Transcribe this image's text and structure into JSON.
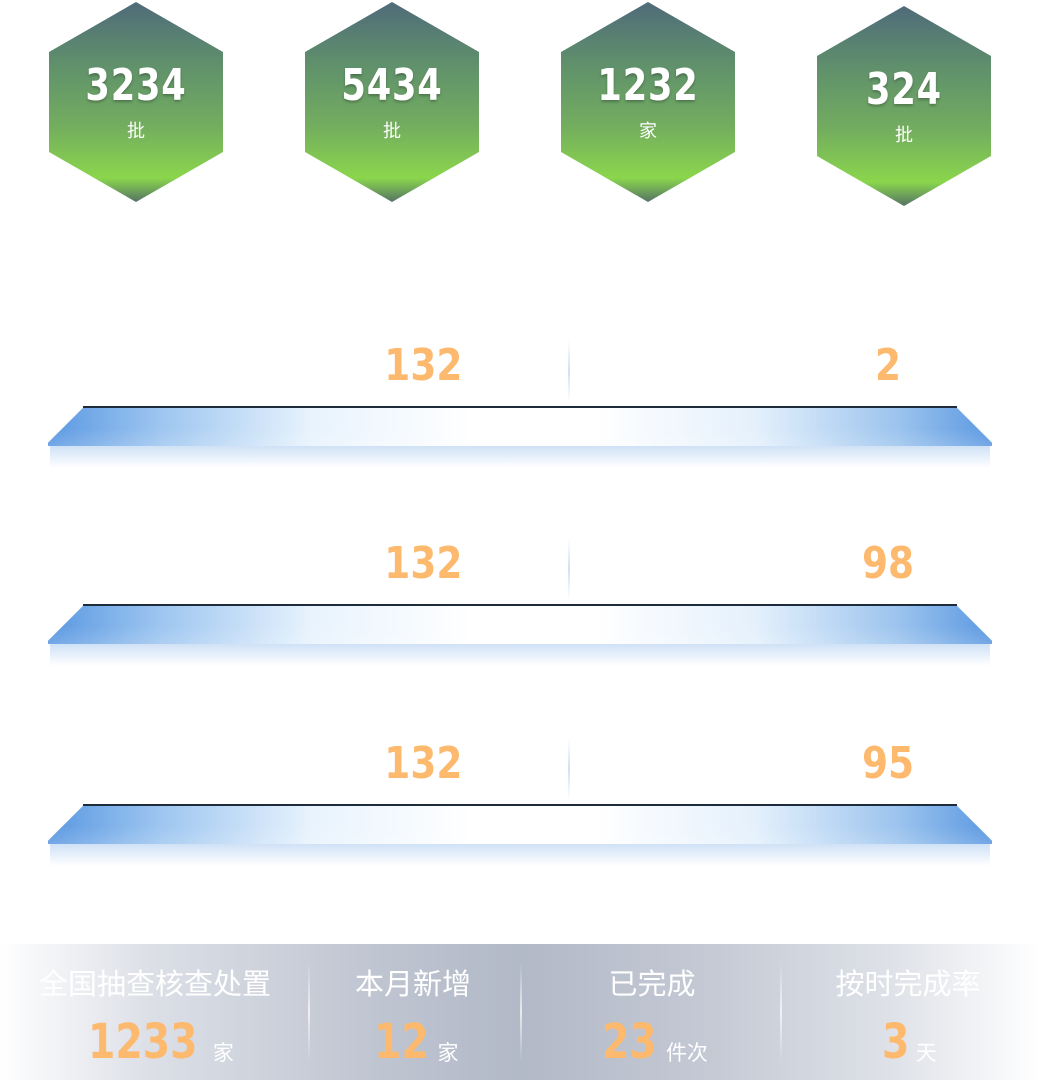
{
  "hexagons": [
    {
      "value": "3234",
      "unit": "批"
    },
    {
      "value": "5434",
      "unit": "批"
    },
    {
      "value": "1232",
      "unit": "家"
    },
    {
      "value": "324",
      "unit": "批"
    }
  ],
  "rows": [
    {
      "left_value": "132",
      "right_value": "2"
    },
    {
      "left_value": "132",
      "right_value": "98"
    },
    {
      "left_value": "132",
      "right_value": "95"
    }
  ],
  "footer": [
    {
      "label": "全国抽查核查处置",
      "value": "1233",
      "unit": "家"
    },
    {
      "label": "本月新增",
      "value": "12",
      "unit": "家"
    },
    {
      "label": "已完成",
      "value": "23",
      "unit": "件次"
    },
    {
      "label": "按时完成率",
      "value": "3",
      "unit": "天"
    }
  ],
  "colors": {
    "accent_orange": "#fdb96d",
    "hex_top": "#4f6b79",
    "hex_bottom": "#8ad64c",
    "bar_blue": "#5a98e2"
  }
}
